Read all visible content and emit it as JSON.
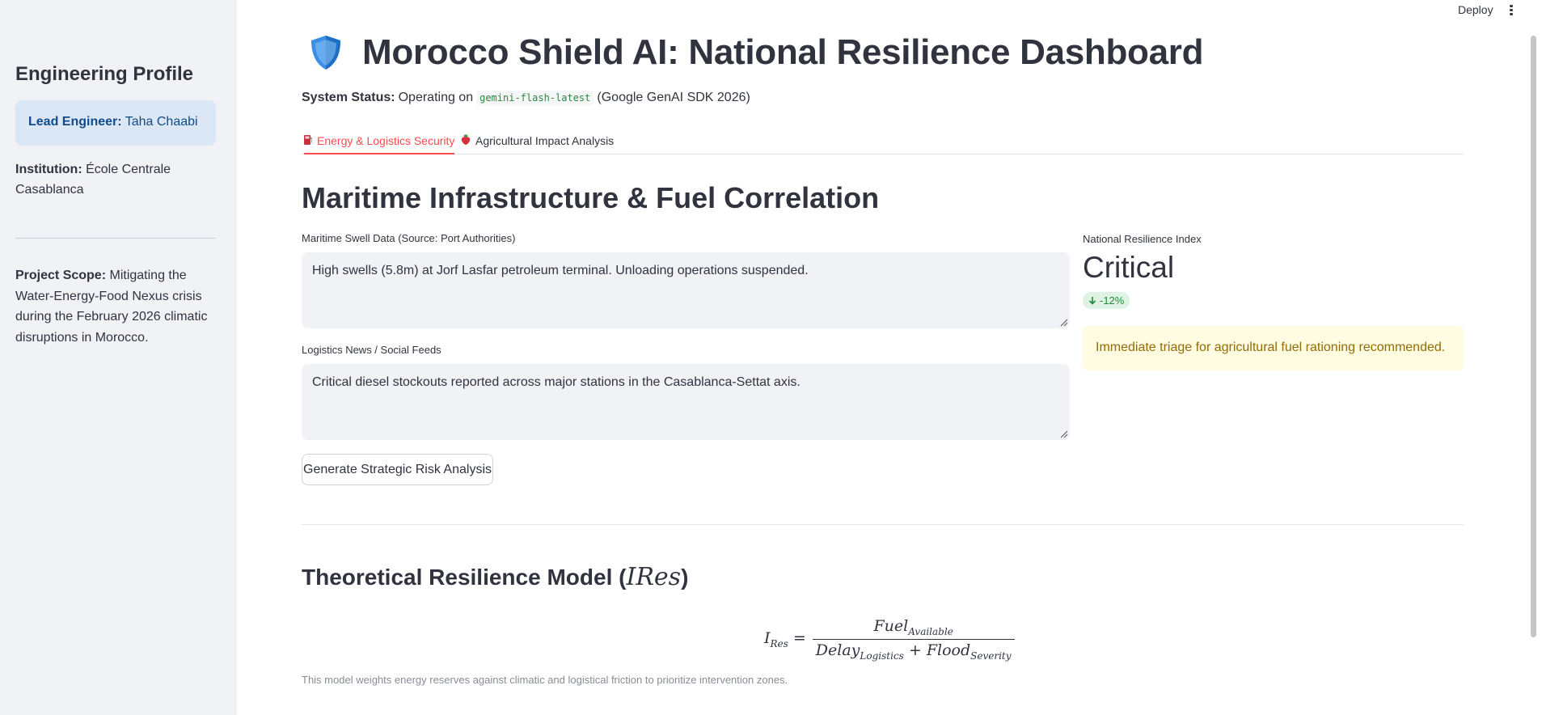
{
  "sidebar": {
    "title": "Engineering Profile",
    "lead_label": "Lead Engineer:",
    "lead_value": "Taha Chaabi",
    "institution_label": "Institution:",
    "institution_value": "École Centrale Casablanca",
    "scope_label": "Project Scope:",
    "scope_value": "Mitigating the Water-Energy-Food Nexus crisis during the February 2026 climatic disruptions in Morocco."
  },
  "header": {
    "deploy_label": "Deploy",
    "title": "Morocco Shield AI: National Resilience Dashboard",
    "status_label": "System Status:",
    "status_text": "Operating on",
    "model_code": "gemini-flash-latest",
    "status_suffix": "(Google GenAI SDK 2026)"
  },
  "tabs": [
    {
      "label": "Energy & Logistics Security",
      "icon": "fuel-pump-icon",
      "active": true
    },
    {
      "label": "Agricultural Impact Analysis",
      "icon": "strawberry-icon",
      "active": false
    }
  ],
  "main": {
    "section_title": "Maritime Infrastructure & Fuel Correlation",
    "swell_label": "Maritime Swell Data (Source: Port Authorities)",
    "swell_value": "High swells (5.8m) at Jorf Lasfar petroleum terminal. Unloading operations suspended.",
    "news_label": "Logistics News / Social Feeds",
    "news_value": "Critical diesel stockouts reported across major stations in the Casablanca-Settat axis.",
    "button_label": "Generate Strategic Risk Analysis"
  },
  "metric": {
    "label": "National Resilience Index",
    "value": "Critical",
    "delta": "-12%",
    "delta_color": "#1f8b3a",
    "warning": "Immediate triage for agricultural fuel rationing recommended."
  },
  "model": {
    "title_prefix": "Theoretical Resilience Model (",
    "title_var": "I",
    "title_sub": "Res",
    "title_suffix": ")",
    "caption": "This model weights energy reserves against climatic and logistical friction to prioritize intervention zones."
  },
  "colors": {
    "accent": "#ff4b4b",
    "sidebar_bg": "#f0f2f6",
    "info_bg": "#dce7f5",
    "warning_bg": "#fffce1"
  }
}
